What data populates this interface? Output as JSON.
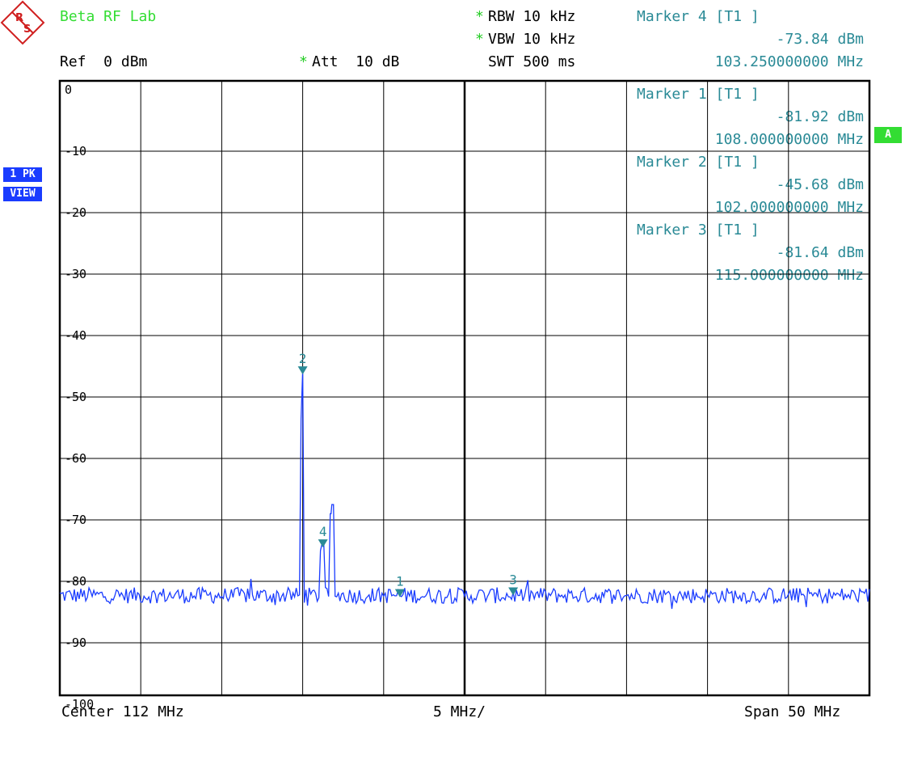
{
  "header": {
    "lab_name": "Beta RF Lab",
    "ref": "Ref  0 dBm",
    "att_star": "*",
    "att": "Att  10 dB",
    "rbw_star": "*",
    "rbw": "RBW 10 kHz",
    "vbw_star": "*",
    "vbw": "VBW 10 kHz",
    "swt": "SWT 500 ms"
  },
  "side": {
    "trace_mode": "1 PK",
    "trace_view": "VIEW",
    "a_badge": "A"
  },
  "readouts": [
    {
      "title": "Marker 4 [T1 ]",
      "level": "-73.84 dBm",
      "freq": "103.250000000 MHz"
    },
    {
      "title": "Marker 1 [T1 ]",
      "level": "-81.92 dBm",
      "freq": "108.000000000 MHz"
    },
    {
      "title": "Marker 2 [T1 ]",
      "level": "-45.68 dBm",
      "freq": "102.000000000 MHz"
    },
    {
      "title": "Marker 3 [T1 ]",
      "level": "-81.64 dBm",
      "freq": "115.000000000 MHz"
    }
  ],
  "footer": {
    "center": "Center 112 MHz",
    "div": "5 MHz/",
    "span": "Span 50 MHz"
  },
  "colors": {
    "trace": "#1a3cff",
    "marker": "#2a8a96",
    "grid": "#000000",
    "title_green": "#33dd33"
  },
  "chart_data": {
    "type": "line",
    "xlim": [
      87,
      137
    ],
    "ylim": [
      -105,
      0
    ],
    "grid": true,
    "x_divisions": 10,
    "y_ticks": [
      {
        "v": 0,
        "label": "0"
      },
      {
        "v": -10,
        "label": "-10"
      },
      {
        "v": -20,
        "label": "-20"
      },
      {
        "v": -30,
        "label": "-30"
      },
      {
        "v": -40,
        "label": "-40"
      },
      {
        "v": -50,
        "label": "-50"
      },
      {
        "v": -60,
        "label": "-60"
      },
      {
        "v": -70,
        "label": "-70"
      },
      {
        "v": -80,
        "label": "-80"
      },
      {
        "v": -90,
        "label": "-90"
      },
      {
        "v": -100,
        "label": "-100"
      }
    ],
    "noise_floor": -82.3,
    "noise_amplitude": 1.3,
    "peaks": [
      {
        "x": 101.9,
        "y": -53.5
      },
      {
        "x": 102.0,
        "y": -45.68
      },
      {
        "x": 103.1,
        "y": -75.0
      },
      {
        "x": 103.25,
        "y": -73.84
      },
      {
        "x": 103.75,
        "y": -69.0
      },
      {
        "x": 103.85,
        "y": -67.5
      },
      {
        "x": 98.8,
        "y": -79.6
      }
    ],
    "markers": [
      {
        "id": "1",
        "x": 108.0,
        "y": -81.92
      },
      {
        "id": "2",
        "x": 102.0,
        "y": -45.68
      },
      {
        "id": "3",
        "x": 115.0,
        "y": -81.64
      },
      {
        "id": "4",
        "x": 103.25,
        "y": -73.84
      }
    ]
  }
}
